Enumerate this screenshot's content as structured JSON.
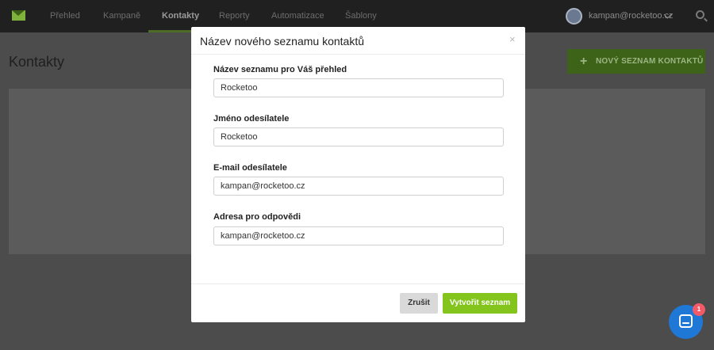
{
  "nav": {
    "items": [
      {
        "label": "Přehled"
      },
      {
        "label": "Kampaně"
      },
      {
        "label": "Kontakty"
      },
      {
        "label": "Reporty"
      },
      {
        "label": "Automatizace"
      },
      {
        "label": "Šablony"
      }
    ],
    "active": "Kontakty",
    "user_email": "kampan@rocketoo.cz"
  },
  "page": {
    "title": "Kontakty",
    "new_list_button": "NOVÝ SEZNAM KONTAKTŮ"
  },
  "modal": {
    "title": "Název nového seznamu kontaktů",
    "close_glyph": "×",
    "fields": [
      {
        "label": "Název seznamu pro Váš přehled",
        "value": "Rocketoo"
      },
      {
        "label": "Jméno odesílatele",
        "value": "Rocketoo"
      },
      {
        "label": "E-mail odesílatele",
        "value": "kampan@rocketoo.cz"
      },
      {
        "label": "Adresa pro odpovědi",
        "value": "kampan@rocketoo.cz"
      }
    ],
    "cancel_label": "Zrušit",
    "submit_label": "Vytvořit seznam"
  },
  "chat": {
    "badge_count": "1"
  },
  "colors": {
    "accent_green": "#83c51d",
    "overlay": "#4c4c4c",
    "chat_blue": "#1f77d6",
    "badge_red": "#f25a68"
  }
}
